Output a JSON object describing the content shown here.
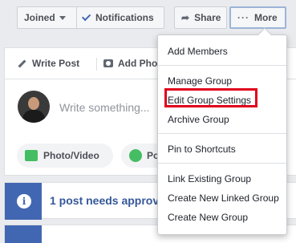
{
  "toolbar": {
    "joined_label": "Joined",
    "notifications_label": "Notifications",
    "share_label": "Share",
    "more_label": "More"
  },
  "composer": {
    "tabs": [
      {
        "label": "Write Post",
        "icon": "pencil-icon"
      },
      {
        "label": "Add Pho",
        "icon": "camera-icon"
      }
    ],
    "placeholder": "Write something...",
    "actions": [
      {
        "label": "Photo/Video",
        "icon": "photo-icon"
      },
      {
        "label": "Po",
        "icon": "poll-icon"
      }
    ]
  },
  "notice": {
    "text": "1 post needs approv"
  },
  "more_menu": {
    "items": [
      {
        "label": "Add Members"
      },
      {
        "label": "Manage Group"
      },
      {
        "label": "Edit Group Settings",
        "highlighted": true
      },
      {
        "label": "Archive Group"
      },
      {
        "label": "Pin to Shortcuts"
      },
      {
        "label": "Link Existing Group"
      },
      {
        "label": "Create New Linked Group"
      },
      {
        "label": "Create New Group"
      }
    ]
  },
  "colors": {
    "accent": "#4267b2",
    "link": "#365899",
    "highlight_box": "#e0001b",
    "page_bg": "#e9ebee"
  }
}
